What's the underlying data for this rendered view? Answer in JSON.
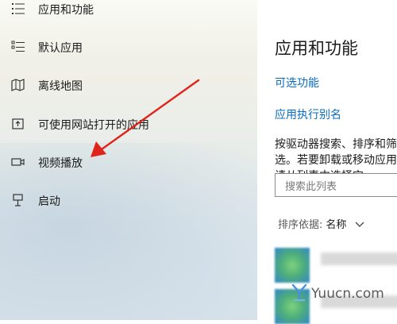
{
  "sidebar": {
    "items": [
      {
        "label": "应用和功能",
        "icon": "apps-features-icon"
      },
      {
        "label": "默认应用",
        "icon": "default-apps-icon"
      },
      {
        "label": "离线地图",
        "icon": "offline-maps-icon"
      },
      {
        "label": "可使用网站打开的应用",
        "icon": "apps-for-websites-icon"
      },
      {
        "label": "视频播放",
        "icon": "video-playback-icon"
      },
      {
        "label": "启动",
        "icon": "startup-icon"
      }
    ]
  },
  "main": {
    "title": "应用和功能",
    "optional_features_link": "可选功能",
    "app_execution_alias_link": "应用执行别名",
    "description": "按驱动器搜索、排序和筛选。若要卸载或移动应用，请从列表中选择它。",
    "search_placeholder": "搜索此列表",
    "sort_label": "排序依据:",
    "sort_value": "名称"
  },
  "annotation": {
    "arrow_color": "#e0241b"
  },
  "watermark": {
    "text": "Yuucn.com"
  },
  "colors": {
    "link": "#0a6cbd",
    "accent_green": "#4fae7a"
  }
}
